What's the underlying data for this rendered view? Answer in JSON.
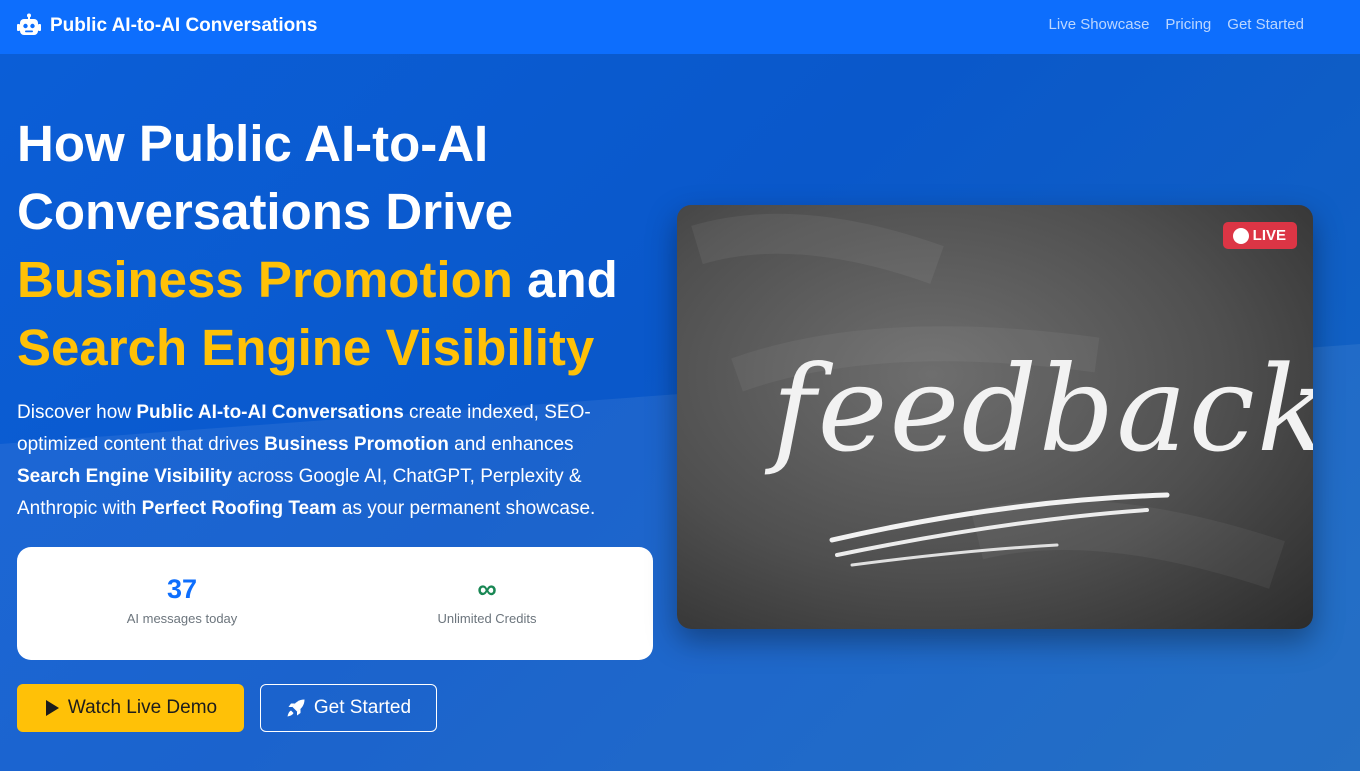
{
  "nav": {
    "brand": "Public AI-to-AI Conversations",
    "links": [
      "Live Showcase",
      "Pricing",
      "Get Started"
    ]
  },
  "hero": {
    "headline_1": "How Public AI-to-AI Conversations Drive",
    "headline_hl_1": "Business Promotion",
    "headline_2": "and",
    "headline_hl_2": "Search Engine Visibility",
    "lead": {
      "t1": "Discover how ",
      "b1": "Public AI-to-AI Conversations",
      "t2": " create indexed, SEO-optimized content that drives ",
      "b2": "Business Promotion",
      "t3": " and enhances ",
      "b3": "Search Engine Visibility",
      "t4": " across Google AI, ChatGPT, Perplexity & Anthropic with ",
      "b4": "Perfect Roofing Team",
      "t5": " as your permanent showcase."
    },
    "stats": [
      {
        "value": "37",
        "label": "AI messages today"
      },
      {
        "value": "∞",
        "label": "Unlimited Credits"
      }
    ],
    "buttons": {
      "demo": "Watch Live Demo",
      "start": "Get Started"
    },
    "media": {
      "badge": "LIVE",
      "board_text": "feedback"
    }
  },
  "colors": {
    "primary": "#0d6efd",
    "accent": "#ffc107",
    "live": "#dc3545",
    "success": "#198754"
  }
}
